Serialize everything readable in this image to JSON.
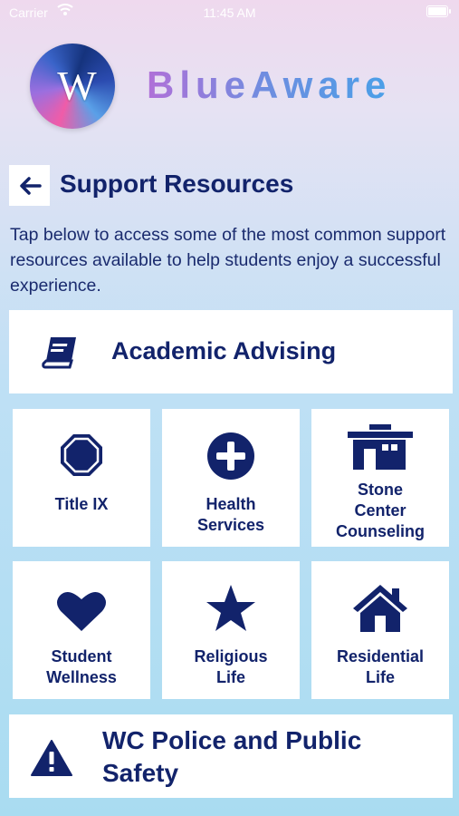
{
  "status_bar": {
    "carrier": "Carrier",
    "time": "11:45 AM"
  },
  "header": {
    "brand": "BlueAware",
    "logo_monogram": "W"
  },
  "nav": {
    "title": "Support Resources"
  },
  "intro": "Tap below to access some of the most common support resources available to help students enjoy a successful experience.",
  "resources": {
    "academic_advising": {
      "label": "Academic Advising",
      "icon": "book-icon"
    },
    "title_ix": {
      "label": "Title IX",
      "icon": "octagon-icon"
    },
    "health_services": {
      "label": "Health\nServices",
      "icon": "plus-circle-icon"
    },
    "stone_center": {
      "label": "Stone\nCenter\nCounseling",
      "icon": "building-icon"
    },
    "student_wellness": {
      "label": "Student\nWellness",
      "icon": "heart-icon"
    },
    "religious_life": {
      "label": "Religious\nLife",
      "icon": "star-icon"
    },
    "residential_life": {
      "label": "Residential\nLife",
      "icon": "house-icon"
    },
    "police": {
      "label": "WC Police and Public\nSafety",
      "icon": "warning-icon"
    }
  },
  "colors": {
    "accent": "#12236b",
    "card": "#ffffff"
  }
}
